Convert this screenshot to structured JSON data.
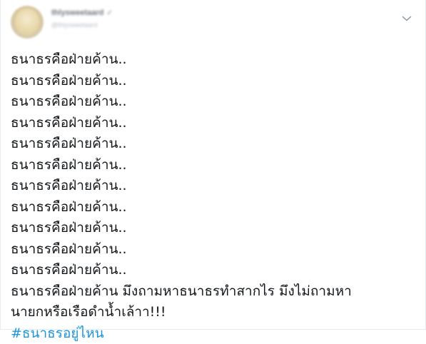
{
  "tweet": {
    "author": {
      "display_name": "thlysweetaard",
      "handle": "@thlysweetaard"
    },
    "menu_icon": "chevron-down-icon",
    "lines": [
      "ธนาธรคือฝ่ายค้าน..",
      "ธนาธรคือฝ่ายค้าน..",
      "ธนาธรคือฝ่ายค้าน..",
      "ธนาธรคือฝ่ายค้าน..",
      "ธนาธรคือฝ่ายค้าน..",
      "ธนาธรคือฝ่ายค้าน..",
      "ธนาธรคือฝ่ายค้าน..",
      "ธนาธรคือฝ่ายค้าน..",
      "ธนาธรคือฝ่ายค้าน..",
      "ธนาธรคือฝ่ายค้าน..",
      "ธนาธรคือฝ่ายค้าน..",
      "ธนาธรคือฝ่ายค้าน มึงถามหาธนาธรทำสากไร มึงไม่ถามหา",
      "นายกหรือเรือดำน้ำเล้าา!!!"
    ],
    "hashtag": "#ธนาธรอยู่ไหน",
    "colors": {
      "text": "#14171a",
      "hashtag": "#1b95e0",
      "border": "#e6ecf0"
    }
  }
}
